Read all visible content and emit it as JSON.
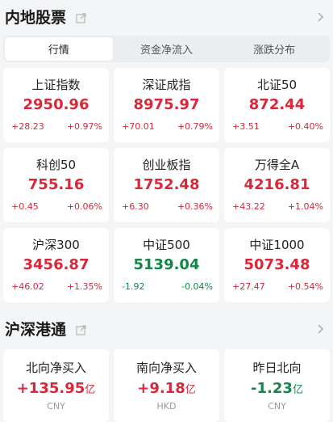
{
  "market": {
    "title": "内地股票",
    "tabs": [
      "行情",
      "资金净流入",
      "涨跌分布"
    ],
    "active_tab": 0,
    "indices": [
      {
        "name": "上证指数",
        "value": "2950.96",
        "change": "+28.23",
        "pct": "+0.97%",
        "dir": "up"
      },
      {
        "name": "深证成指",
        "value": "8975.97",
        "change": "+70.01",
        "pct": "+0.79%",
        "dir": "up"
      },
      {
        "name": "北证50",
        "value": "872.44",
        "change": "+3.51",
        "pct": "+0.40%",
        "dir": "up"
      },
      {
        "name": "科创50",
        "value": "755.16",
        "change": "+0.45",
        "pct": "+0.06%",
        "dir": "up"
      },
      {
        "name": "创业板指",
        "value": "1752.48",
        "change": "+6.30",
        "pct": "+0.36%",
        "dir": "up"
      },
      {
        "name": "万得全A",
        "value": "4216.81",
        "change": "+43.22",
        "pct": "+1.04%",
        "dir": "up"
      },
      {
        "name": "沪深300",
        "value": "3456.87",
        "change": "+46.02",
        "pct": "+1.35%",
        "dir": "up"
      },
      {
        "name": "中证500",
        "value": "5139.04",
        "change": "-1.92",
        "pct": "-0.04%",
        "dir": "down"
      },
      {
        "name": "中证1000",
        "value": "5073.48",
        "change": "+27.47",
        "pct": "+0.54%",
        "dir": "up"
      }
    ]
  },
  "connect": {
    "title": "沪深港通",
    "items": [
      {
        "name": "北向净买入",
        "value": "+135.95",
        "unit": "亿",
        "currency": "CNY",
        "dir": "up"
      },
      {
        "name": "南向净买入",
        "value": "+9.18",
        "unit": "亿",
        "currency": "HKD",
        "dir": "up"
      },
      {
        "name": "昨日北向",
        "value": "-1.23",
        "unit": "亿",
        "currency": "CNY",
        "dir": "down"
      }
    ]
  },
  "colors": {
    "up": "#d8283a",
    "down": "#13864a",
    "background": "#f4f5f7"
  },
  "icons": {
    "external": "external-link-icon",
    "more": "chevron-right-icon"
  }
}
